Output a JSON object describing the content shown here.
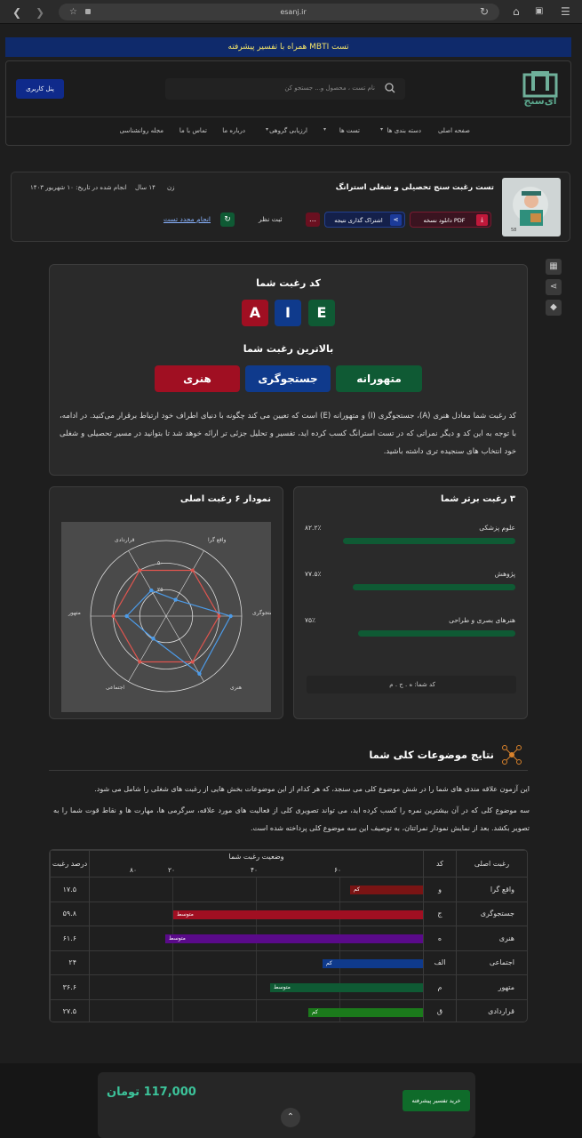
{
  "browser": {
    "url": "esanj.ir"
  },
  "banner": {
    "text": "تست MBTI همراه با تفسیر پیشرفته"
  },
  "header": {
    "panel_button": "پنل کاربری",
    "search_placeholder": "نام تست ، محصول و... جستجو کن",
    "logo_text": "ای‌سنج",
    "nav": [
      "صفحه اصلی",
      "دسته بندی ها",
      "تست ها",
      "ارزیابی گروهی",
      "درباره ما",
      "تماس با ما",
      "مجله روانشناسی"
    ]
  },
  "test": {
    "title": "تست رغبت سنج تحصیلی و شغلی استرانگ",
    "gender": "زن",
    "age": "۱۴ سال",
    "date": "انجام شده در تاریخ: ۱۰ شهریور ۱۴۰۳",
    "download": "دانلود نسخه PDF",
    "share": "اشتراک گذاری نتیجه",
    "record": "ثبت نظر",
    "redo": "انجام مجدد تست",
    "thumb_badge": "58"
  },
  "code": {
    "title": "کد رغبت شما",
    "letters": [
      "E",
      "I",
      "A"
    ],
    "top_title": "بالاترین رغبت شما",
    "top": [
      "متهورانه",
      "جستجوگری",
      "هنری"
    ],
    "description": "کد رغبت شما معادل هنری (A)، جستجوگری (I) و متهورانه (E) است که تعیین می کند چگونه با دنیای اطراف خود ارتباط برقرار می‌کنید. در ادامه، با توجه به این کد و دیگر نمراتی که در تست استرانگ کسب کرده اید، تفسیر و تحلیل جزئی تر ارائه خوهد شد تا بتوانید در مسیر تحصیلی و شغلی خود انتخاب های سنجیده تری داشته باشید."
  },
  "top3": {
    "title": "۳ رغبت برتر شما",
    "items": [
      {
        "label": "علوم پزشکی",
        "value": "۸۲.۲٪",
        "fraction": 0.822
      },
      {
        "label": "پژوهش",
        "value": "۷۷.۵٪",
        "fraction": 0.775
      },
      {
        "label": "هنرهای بصری و طراحی",
        "value": "۷۵٪",
        "fraction": 0.75
      }
    ],
    "code_label": "کد شما: ه . ج . م"
  },
  "radar": {
    "title": "نمودار ۶ رغبت اصلی",
    "axes": [
      "واقع گرا",
      "جستجوگری",
      "هنری",
      "اجتماعی",
      "متهور",
      "قراردادی"
    ],
    "ring_labels": [
      "۲۵",
      "۵۰"
    ]
  },
  "general": {
    "title": "نتایج موضوعات کلی شما",
    "p1": "این آزمون علاقه مندی های شما را در شش موضوع کلی می سنجد، که هر کدام از این موضوعات بخش هایی از رغبت های شغلی را شامل می شود.",
    "p2": "سه موضوع کلی که در آن بیشترین نمره را کسب کرده اید، می تواند تصویری کلی از فعالیت های مورد علاقه، سرگرمی ها، مهارت ها و نقاط قوت شما را به تصویر بکشد. بعد از نمایش نمودار نمراتتان، به توصیف این سه موضوع کلی پرداخته شده است."
  },
  "table": {
    "headers": {
      "main": "رغبت اصلی",
      "code": "کد",
      "status": "وضعیت رغبت شما",
      "pct": "درصد رغبت"
    },
    "scale": [
      "۲۰",
      "۴۰",
      "۶۰",
      "۸۰"
    ],
    "rows": [
      {
        "name": "واقع گرا",
        "code": "و",
        "level": "کم",
        "pct": "۱۷.۵",
        "value": 17.5,
        "color": "#7a1414"
      },
      {
        "name": "جستجوگری",
        "code": "ج",
        "level": "متوسط",
        "pct": "۵۹.۸",
        "value": 59.8,
        "color": "#a00f22"
      },
      {
        "name": "هنری",
        "code": "ه",
        "level": "متوسط",
        "pct": "۶۱.۶",
        "value": 61.6,
        "color": "#5a0a8a"
      },
      {
        "name": "اجتماعی",
        "code": "الف",
        "level": "کم",
        "pct": "۲۴",
        "value": 24,
        "color": "#0f3a8c"
      },
      {
        "name": "متهور",
        "code": "م",
        "level": "متوسط",
        "pct": "۳۶.۶",
        "value": 36.6,
        "color": "#0f5a34"
      },
      {
        "name": "قراردادی",
        "code": "ق",
        "level": "کم",
        "pct": "۲۷.۵",
        "value": 27.5,
        "color": "#1b7a1b"
      }
    ]
  },
  "purchase": {
    "price": "117,000 تومان",
    "button": "خرید تفسیر پیشرفته"
  },
  "colors": {
    "red": "#a00f22",
    "blue": "#0f3a8c",
    "green": "#0f5a34",
    "banner": "#0f2a6b"
  }
}
